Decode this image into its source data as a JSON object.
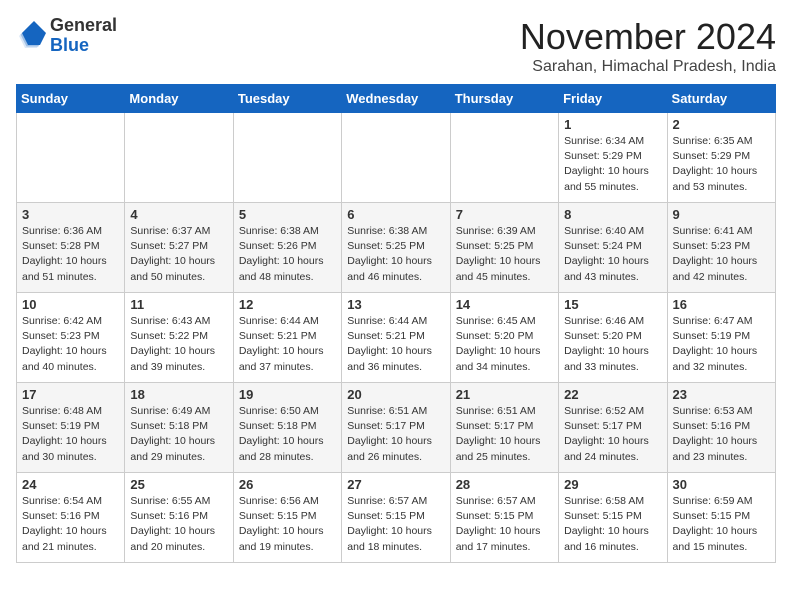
{
  "logo": {
    "general": "General",
    "blue": "Blue"
  },
  "header": {
    "month": "November 2024",
    "location": "Sarahan, Himachal Pradesh, India"
  },
  "weekdays": [
    "Sunday",
    "Monday",
    "Tuesday",
    "Wednesday",
    "Thursday",
    "Friday",
    "Saturday"
  ],
  "weeks": [
    [
      {
        "day": "",
        "info": ""
      },
      {
        "day": "",
        "info": ""
      },
      {
        "day": "",
        "info": ""
      },
      {
        "day": "",
        "info": ""
      },
      {
        "day": "",
        "info": ""
      },
      {
        "day": "1",
        "info": "Sunrise: 6:34 AM\nSunset: 5:29 PM\nDaylight: 10 hours\nand 55 minutes."
      },
      {
        "day": "2",
        "info": "Sunrise: 6:35 AM\nSunset: 5:29 PM\nDaylight: 10 hours\nand 53 minutes."
      }
    ],
    [
      {
        "day": "3",
        "info": "Sunrise: 6:36 AM\nSunset: 5:28 PM\nDaylight: 10 hours\nand 51 minutes."
      },
      {
        "day": "4",
        "info": "Sunrise: 6:37 AM\nSunset: 5:27 PM\nDaylight: 10 hours\nand 50 minutes."
      },
      {
        "day": "5",
        "info": "Sunrise: 6:38 AM\nSunset: 5:26 PM\nDaylight: 10 hours\nand 48 minutes."
      },
      {
        "day": "6",
        "info": "Sunrise: 6:38 AM\nSunset: 5:25 PM\nDaylight: 10 hours\nand 46 minutes."
      },
      {
        "day": "7",
        "info": "Sunrise: 6:39 AM\nSunset: 5:25 PM\nDaylight: 10 hours\nand 45 minutes."
      },
      {
        "day": "8",
        "info": "Sunrise: 6:40 AM\nSunset: 5:24 PM\nDaylight: 10 hours\nand 43 minutes."
      },
      {
        "day": "9",
        "info": "Sunrise: 6:41 AM\nSunset: 5:23 PM\nDaylight: 10 hours\nand 42 minutes."
      }
    ],
    [
      {
        "day": "10",
        "info": "Sunrise: 6:42 AM\nSunset: 5:23 PM\nDaylight: 10 hours\nand 40 minutes."
      },
      {
        "day": "11",
        "info": "Sunrise: 6:43 AM\nSunset: 5:22 PM\nDaylight: 10 hours\nand 39 minutes."
      },
      {
        "day": "12",
        "info": "Sunrise: 6:44 AM\nSunset: 5:21 PM\nDaylight: 10 hours\nand 37 minutes."
      },
      {
        "day": "13",
        "info": "Sunrise: 6:44 AM\nSunset: 5:21 PM\nDaylight: 10 hours\nand 36 minutes."
      },
      {
        "day": "14",
        "info": "Sunrise: 6:45 AM\nSunset: 5:20 PM\nDaylight: 10 hours\nand 34 minutes."
      },
      {
        "day": "15",
        "info": "Sunrise: 6:46 AM\nSunset: 5:20 PM\nDaylight: 10 hours\nand 33 minutes."
      },
      {
        "day": "16",
        "info": "Sunrise: 6:47 AM\nSunset: 5:19 PM\nDaylight: 10 hours\nand 32 minutes."
      }
    ],
    [
      {
        "day": "17",
        "info": "Sunrise: 6:48 AM\nSunset: 5:19 PM\nDaylight: 10 hours\nand 30 minutes."
      },
      {
        "day": "18",
        "info": "Sunrise: 6:49 AM\nSunset: 5:18 PM\nDaylight: 10 hours\nand 29 minutes."
      },
      {
        "day": "19",
        "info": "Sunrise: 6:50 AM\nSunset: 5:18 PM\nDaylight: 10 hours\nand 28 minutes."
      },
      {
        "day": "20",
        "info": "Sunrise: 6:51 AM\nSunset: 5:17 PM\nDaylight: 10 hours\nand 26 minutes."
      },
      {
        "day": "21",
        "info": "Sunrise: 6:51 AM\nSunset: 5:17 PM\nDaylight: 10 hours\nand 25 minutes."
      },
      {
        "day": "22",
        "info": "Sunrise: 6:52 AM\nSunset: 5:17 PM\nDaylight: 10 hours\nand 24 minutes."
      },
      {
        "day": "23",
        "info": "Sunrise: 6:53 AM\nSunset: 5:16 PM\nDaylight: 10 hours\nand 23 minutes."
      }
    ],
    [
      {
        "day": "24",
        "info": "Sunrise: 6:54 AM\nSunset: 5:16 PM\nDaylight: 10 hours\nand 21 minutes."
      },
      {
        "day": "25",
        "info": "Sunrise: 6:55 AM\nSunset: 5:16 PM\nDaylight: 10 hours\nand 20 minutes."
      },
      {
        "day": "26",
        "info": "Sunrise: 6:56 AM\nSunset: 5:15 PM\nDaylight: 10 hours\nand 19 minutes."
      },
      {
        "day": "27",
        "info": "Sunrise: 6:57 AM\nSunset: 5:15 PM\nDaylight: 10 hours\nand 18 minutes."
      },
      {
        "day": "28",
        "info": "Sunrise: 6:57 AM\nSunset: 5:15 PM\nDaylight: 10 hours\nand 17 minutes."
      },
      {
        "day": "29",
        "info": "Sunrise: 6:58 AM\nSunset: 5:15 PM\nDaylight: 10 hours\nand 16 minutes."
      },
      {
        "day": "30",
        "info": "Sunrise: 6:59 AM\nSunset: 5:15 PM\nDaylight: 10 hours\nand 15 minutes."
      }
    ]
  ]
}
